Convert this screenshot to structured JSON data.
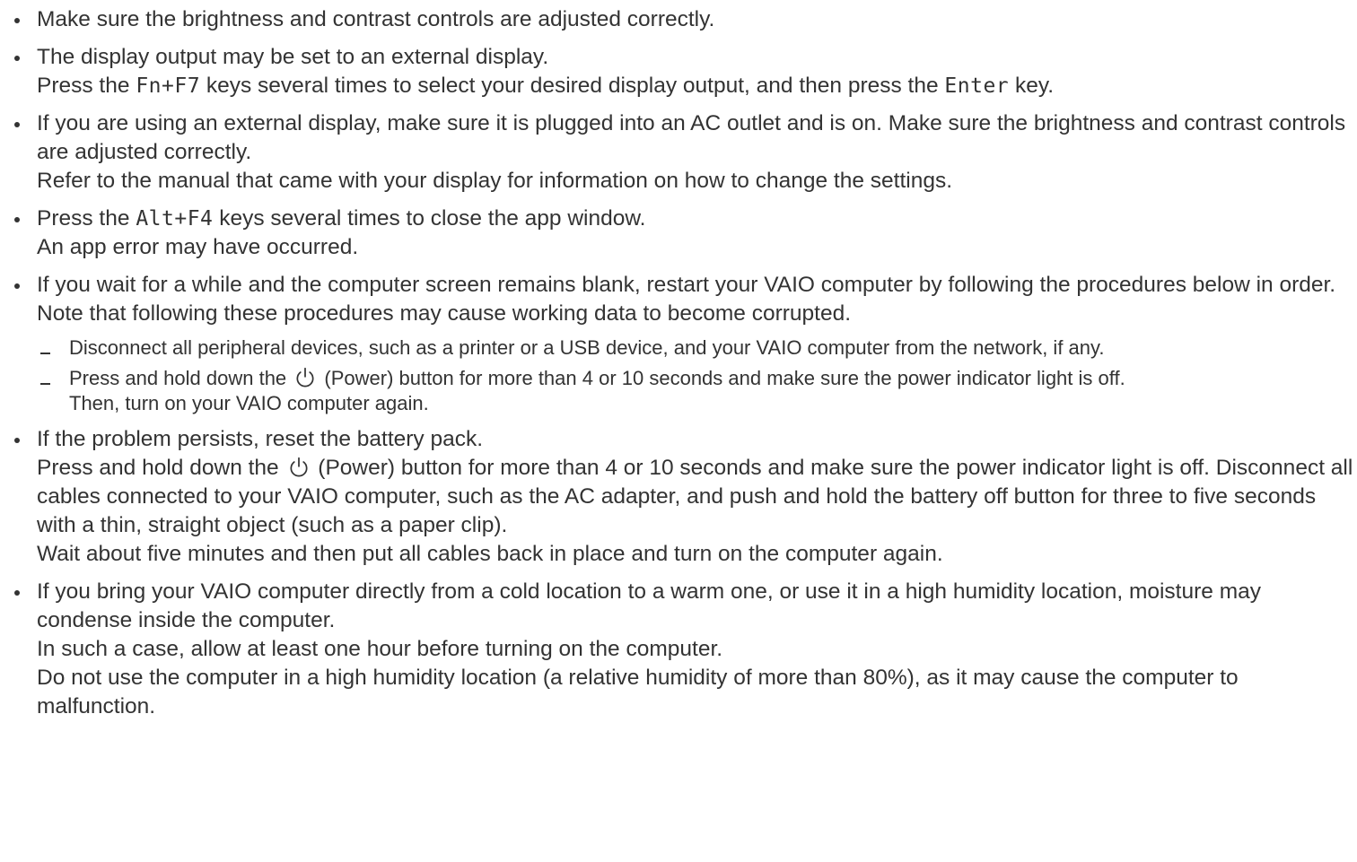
{
  "icons": {
    "power": "power-icon",
    "bullet": "bullet-dot",
    "dash": "dash-marker"
  },
  "colors": {
    "text": "#333333",
    "background": "#ffffff"
  },
  "items": [
    {
      "lines": [
        "Make sure the brightness and contrast controls are adjusted correctly."
      ]
    },
    {
      "line1": "The display output may be set to an external display.",
      "line2_a": "Press the ",
      "key1": "Fn+F7",
      "line2_b": " keys several times to select your desired display output, and then press the ",
      "key2": "Enter",
      "line2_c": " key."
    },
    {
      "line1": "If you are using an external display, make sure it is plugged into an AC outlet and is on. Make sure the brightness and contrast controls are adjusted correctly.",
      "line2": "Refer to the manual that came with your display for information on how to change the settings."
    },
    {
      "line1_a": "Press the ",
      "key1": "Alt+F4",
      "line1_b": " keys several times to close the app window.",
      "line2": "An app error may have occurred."
    },
    {
      "line1": "If you wait for a while and the computer screen remains blank, restart your VAIO computer by following the procedures below in order. Note that following these procedures may cause working data to become corrupted.",
      "subs": [
        {
          "text": "Disconnect all peripheral devices, such as a printer or a USB device, and your VAIO computer from the network, if any."
        },
        {
          "text_a": "Press and hold down the ",
          "text_b": " (Power) button for more than 4 or 10 seconds and make sure the power indicator light is off.",
          "text_c": "Then, turn on your VAIO computer again."
        }
      ]
    },
    {
      "line1": "If the problem persists, reset the battery pack.",
      "line2_a": "Press and hold down the ",
      "line2_b": " (Power) button for more than 4 or 10 seconds and make sure the power indicator light is off. Disconnect all cables connected to your VAIO computer, such as the AC adapter, and push and hold the battery off button for three to five seconds with a thin, straight object (such as a paper clip).",
      "line3": "Wait about five minutes and then put all cables back in place and turn on the computer again."
    },
    {
      "line1": "If you bring your VAIO computer directly from a cold location to a warm one, or use it in a high humidity location, moisture may condense inside the computer.",
      "line2": "In such a case, allow at least one hour before turning on the computer.",
      "line3": "Do not use the computer in a high humidity location (a relative humidity of more than 80%), as it may cause the computer to malfunction."
    }
  ]
}
